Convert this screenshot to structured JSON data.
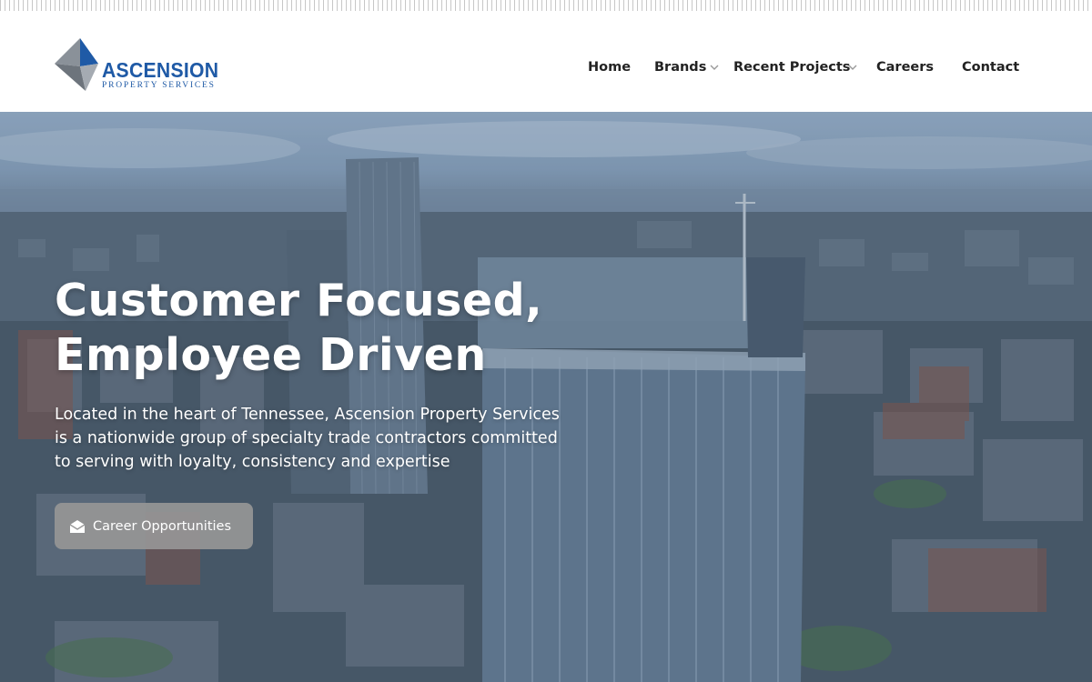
{
  "brand": {
    "name": "ASCENSION",
    "tagline": "PROPERTY SERVICES",
    "color": "#1f5aa6"
  },
  "nav": {
    "items": [
      {
        "label": "Home",
        "has_dropdown": false
      },
      {
        "label": "Brands",
        "has_dropdown": true
      },
      {
        "label": "Recent Projects",
        "has_dropdown": true
      },
      {
        "label": "Careers",
        "has_dropdown": false
      },
      {
        "label": "Contact",
        "has_dropdown": false
      }
    ]
  },
  "hero": {
    "headline_line1": "Customer Focused,",
    "headline_line2": "Employee Driven",
    "lede": "Located in the heart of Tennessee, Ascension Property Services is a nationwide group of specialty trade contractors committed to serving with loyalty, consistency and expertise",
    "cta_label": "Career Opportunities",
    "cta_icon": "envelope-open-icon"
  }
}
